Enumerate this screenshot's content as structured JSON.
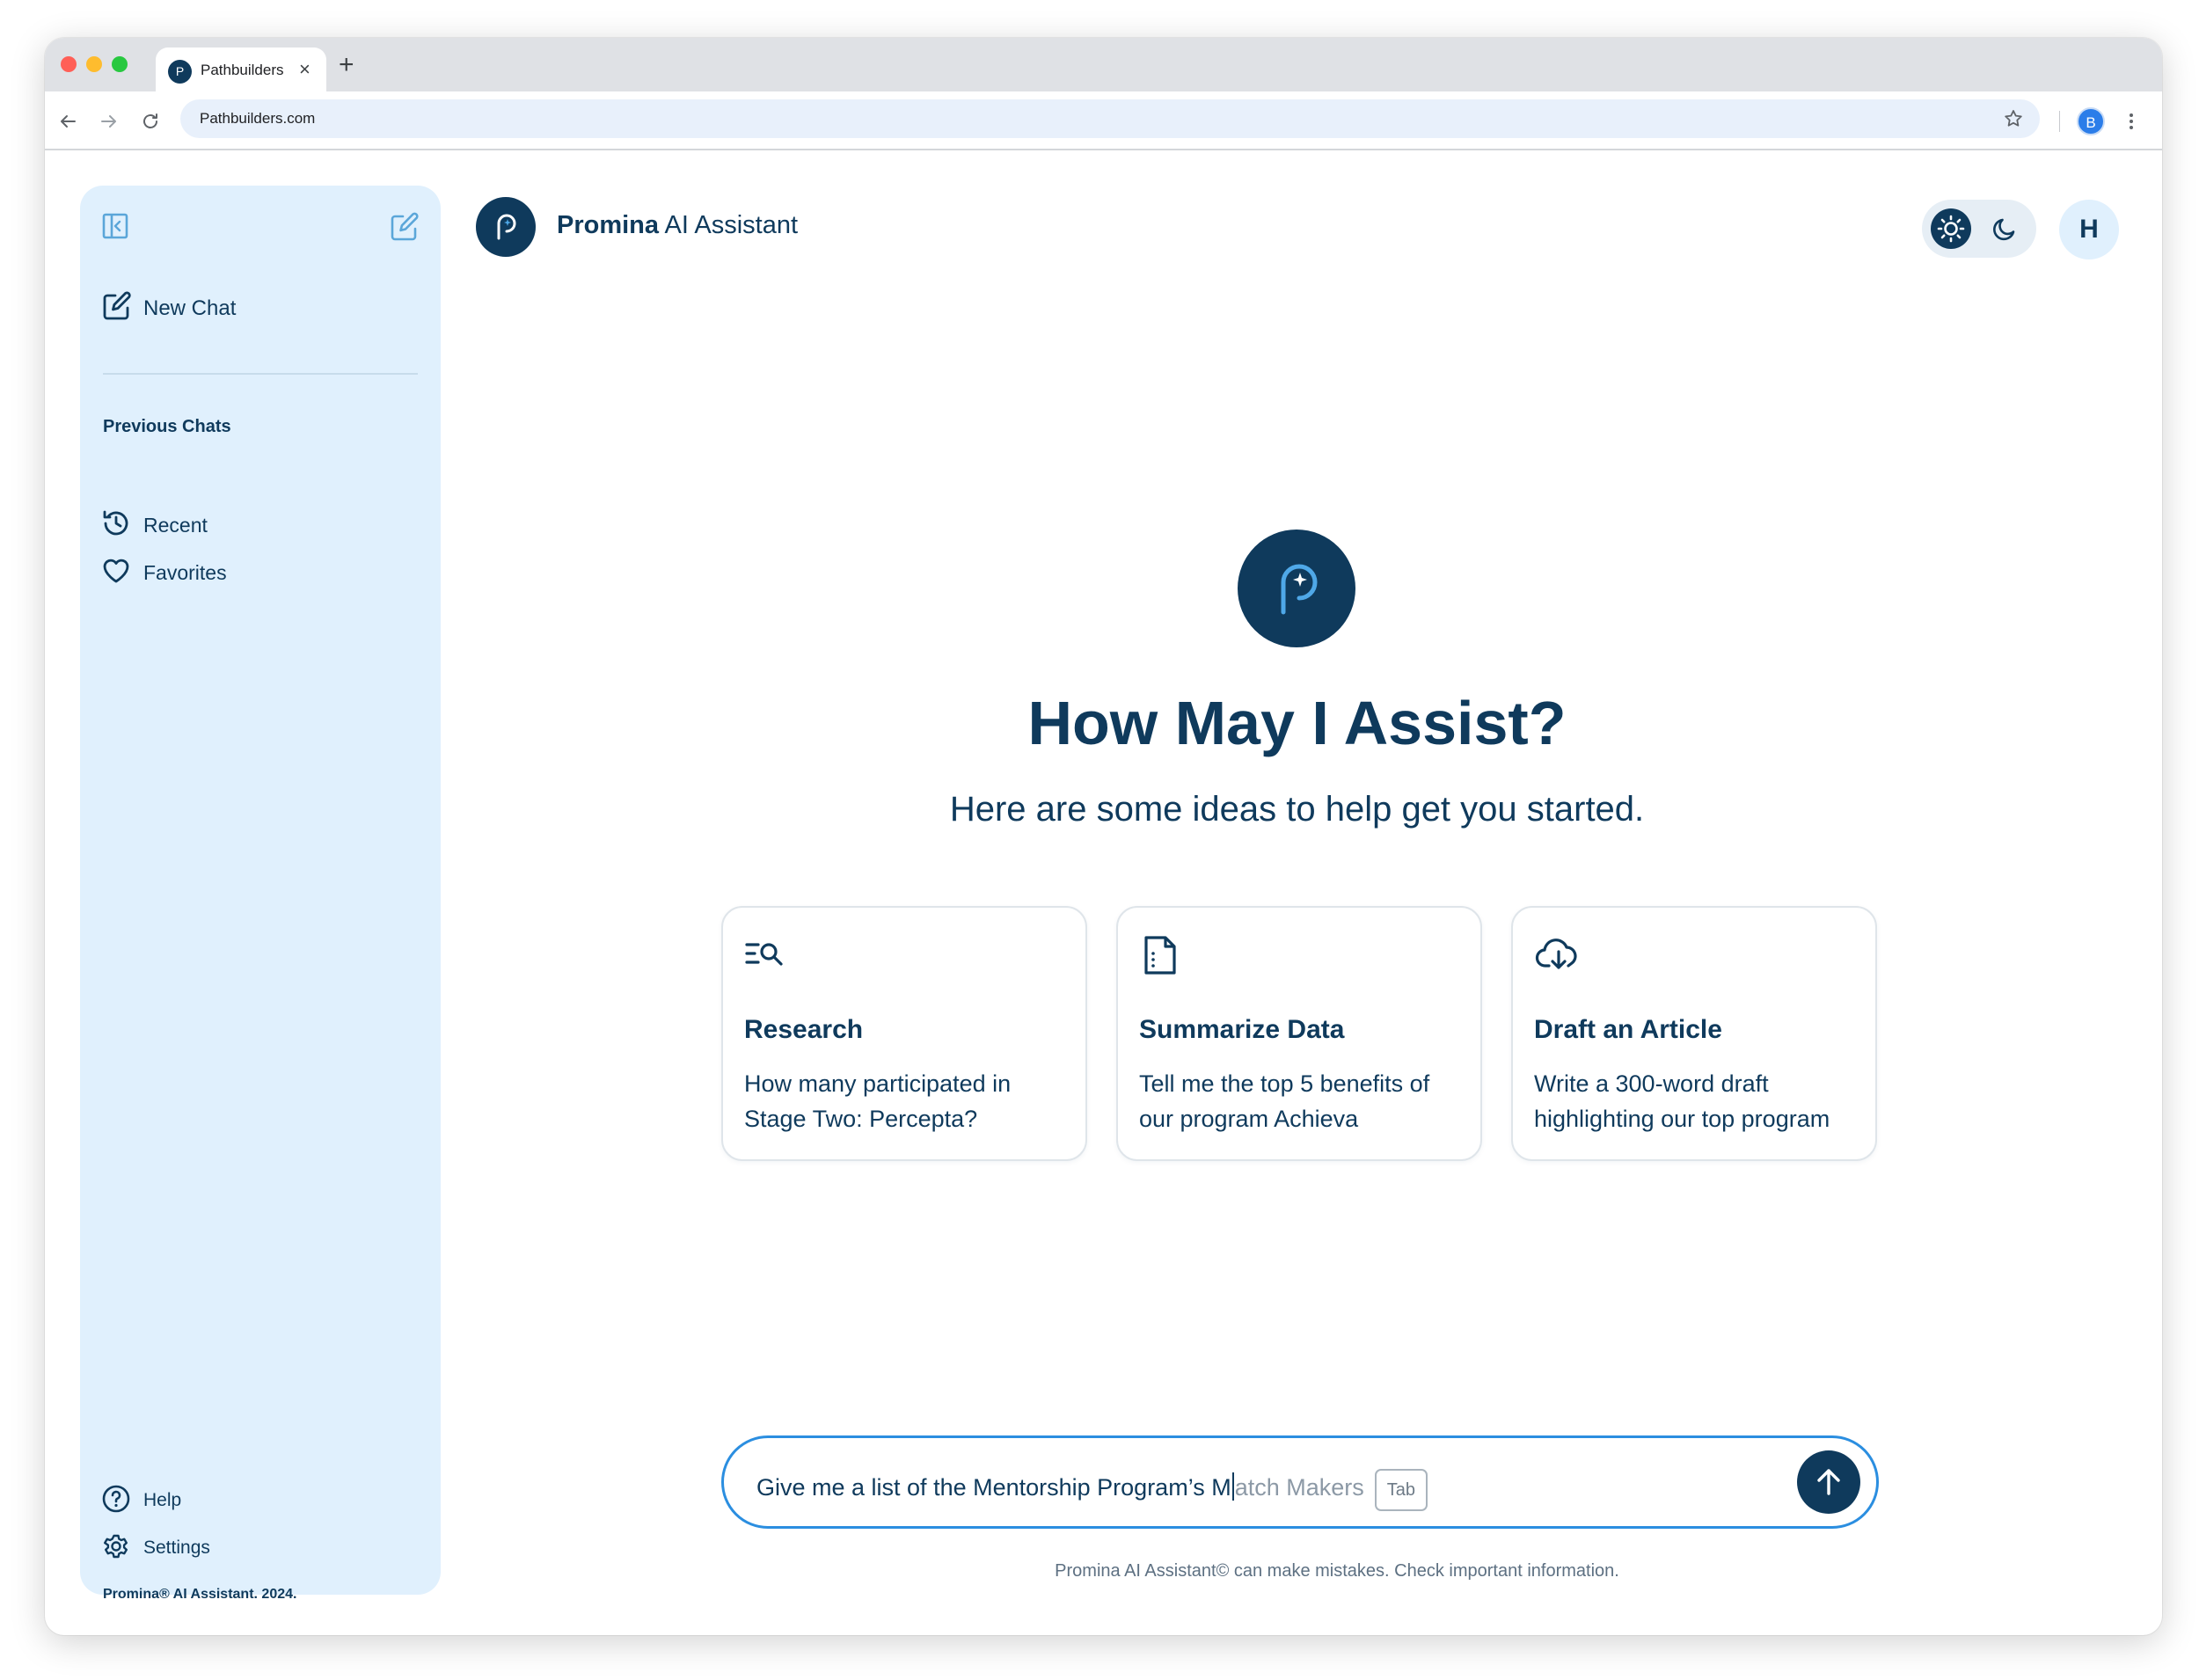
{
  "browser": {
    "tab_title": "Pathbuilders",
    "tab_favicon": "P",
    "tab_close": "×",
    "new_tab": "+",
    "url": "Pathbuilders.com",
    "profile_initial": "B"
  },
  "sidebar": {
    "new_chat": "New Chat",
    "previous_chats_heading": "Previous Chats",
    "recent": "Recent",
    "favorites": "Favorites",
    "help": "Help",
    "settings": "Settings",
    "footer": "Promina® AI Assistant. 2024."
  },
  "header": {
    "brand": "Promina",
    "title_rest": " AI Assistant",
    "user_initial": "H"
  },
  "hero": {
    "title": "How May I Assist?",
    "subtitle": "Here are some ideas to help get you started."
  },
  "cards": [
    {
      "icon": "search-list-icon",
      "title": "Research",
      "description": "How many participated in Stage Two: Percepta?"
    },
    {
      "icon": "document-icon",
      "title": "Summarize Data",
      "description": "Tell me the top 5 benefits of our program Achieva"
    },
    {
      "icon": "cloud-download-icon",
      "title": "Draft an Article",
      "description": "Write a 300-word draft highlighting our top program"
    }
  ],
  "chat_input": {
    "typed": "Give me a list of the Mentorship Program’s M",
    "suggestion": "atch Makers",
    "tab_hint": "Tab"
  },
  "disclaimer": "Promina AI Assistant© can make mistakes. Check important information.",
  "colors": {
    "primary": "#0f3a5c",
    "sidebar_bg": "#e0f0fd",
    "input_border": "#2b8ee0",
    "accent_light": "#4fa8e8"
  }
}
